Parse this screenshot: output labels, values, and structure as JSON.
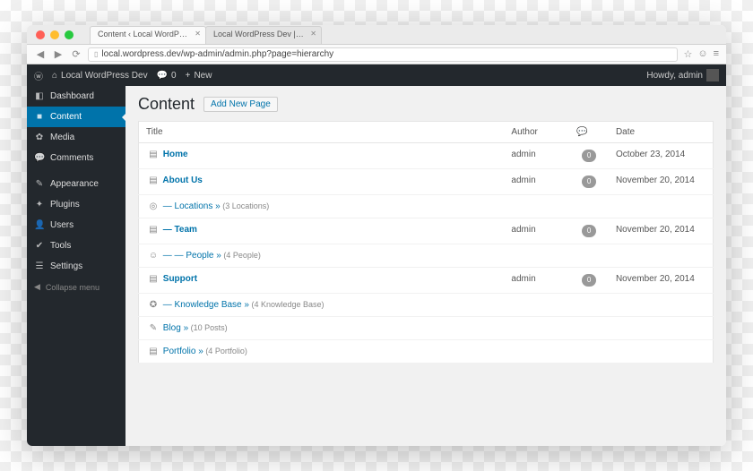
{
  "browser": {
    "tabs": [
      {
        "label": "Content ‹ Local WordPress…"
      },
      {
        "label": "Local WordPress Dev | Ju…"
      }
    ],
    "url_display": "local.wordpress.dev/wp-admin/admin.php?page=hierarchy"
  },
  "adminbar": {
    "site_name": "Local WordPress Dev",
    "comments_count": "0",
    "new_label": "New",
    "greeting": "Howdy, admin"
  },
  "sidebar": {
    "items": [
      {
        "icon": "◧",
        "label": "Dashboard"
      },
      {
        "icon": "■",
        "label": "Content",
        "active": true
      },
      {
        "icon": "✿",
        "label": "Media"
      },
      {
        "icon": "💬",
        "label": "Comments"
      }
    ],
    "items2": [
      {
        "icon": "✎",
        "label": "Appearance"
      },
      {
        "icon": "✦",
        "label": "Plugins"
      },
      {
        "icon": "👤",
        "label": "Users"
      },
      {
        "icon": "✔",
        "label": "Tools"
      },
      {
        "icon": "☰",
        "label": "Settings"
      }
    ],
    "collapse_label": "Collapse menu"
  },
  "page": {
    "title": "Content",
    "add_new": "Add New Page",
    "columns": {
      "title": "Title",
      "author": "Author",
      "comments_icon": "💬",
      "date": "Date"
    },
    "rows": [
      {
        "icon": "▤",
        "title": "Home",
        "author": "admin",
        "comments": "0",
        "date": "October 23, 2014"
      },
      {
        "icon": "▤",
        "title": "About Us",
        "author": "admin",
        "comments": "0",
        "date": "November 20, 2014"
      },
      {
        "icon": "◎",
        "title": "— Locations »",
        "suffix": "(3 Locations)"
      },
      {
        "icon": "▤",
        "title": "— Team",
        "author": "admin",
        "comments": "0",
        "date": "November 20, 2014"
      },
      {
        "icon": "☺",
        "title": "— — People »",
        "suffix": "(4 People)"
      },
      {
        "icon": "▤",
        "title": "Support",
        "author": "admin",
        "comments": "0",
        "date": "November 20, 2014"
      },
      {
        "icon": "✪",
        "title": "— Knowledge Base »",
        "suffix": "(4 Knowledge Base)"
      },
      {
        "icon": "✎",
        "title": "Blog »",
        "suffix": "(10 Posts)"
      },
      {
        "icon": "▤",
        "title": "Portfolio »",
        "suffix": "(4 Portfolio)"
      }
    ]
  }
}
